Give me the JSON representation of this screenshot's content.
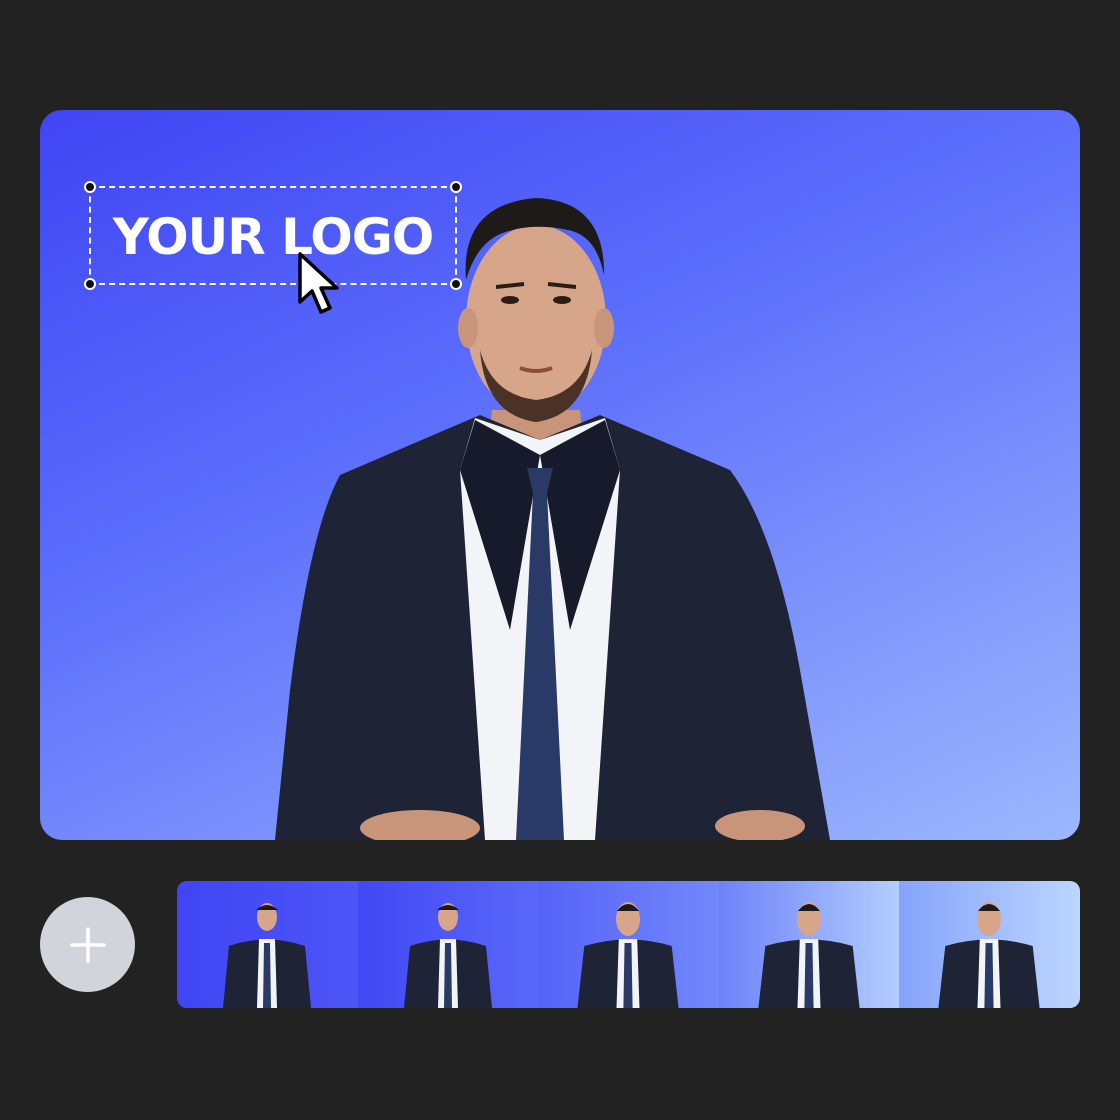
{
  "logo": {
    "text": "YOUR LOGO"
  },
  "colors": {
    "background": "#222222",
    "canvas_gradient": [
      "#3f45f3",
      "#9cb7fd"
    ],
    "add_button": "#d3d3dc",
    "suit": "#1f2336",
    "tie": "#2a3a66",
    "shirt": "#f2f4f8"
  },
  "icons": {
    "cursor": "arrow-cursor-icon",
    "add": "plus-icon"
  },
  "timeline": {
    "clips": [
      {
        "name": "clip-1",
        "bg": [
          "#3f45f3",
          "#4d55f7"
        ]
      },
      {
        "name": "clip-2",
        "bg": [
          "#4148f4",
          "#5a68f9"
        ]
      },
      {
        "name": "clip-3",
        "bg": [
          "#5563f8",
          "#7288fb"
        ]
      },
      {
        "name": "clip-4",
        "bg": [
          "#6d82fa",
          "#b3cdfe"
        ]
      },
      {
        "name": "clip-5",
        "bg": [
          "#86a3fc",
          "#bcd6ff"
        ]
      }
    ]
  }
}
